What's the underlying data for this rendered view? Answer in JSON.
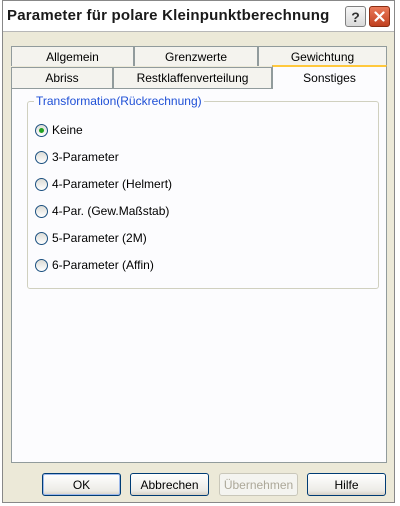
{
  "window": {
    "title": "Parameter für polare Kleinpunktberechnung",
    "help_button": "?",
    "close_button": "close"
  },
  "tabs": {
    "row_back": [
      "Allgemein",
      "Grenzwerte",
      "Gewichtung"
    ],
    "row_front": [
      "Abriss",
      "Restklaffenverteilung",
      "Sonstiges"
    ],
    "active": "Sonstiges"
  },
  "transformation": {
    "group_label": "Transformation(Rückrechnung)",
    "options": [
      {
        "label": "Keine",
        "selected": true
      },
      {
        "label": "3-Parameter",
        "selected": false
      },
      {
        "label": "4-Parameter (Helmert)",
        "selected": false
      },
      {
        "label": "4-Par. (Gew.Maßstab)",
        "selected": false
      },
      {
        "label": "5-Parameter (2M)",
        "selected": false
      },
      {
        "label": "6-Parameter (Affin)",
        "selected": false
      }
    ]
  },
  "buttons": {
    "ok": "OK",
    "cancel": "Abbrechen",
    "apply": "Übernehmen",
    "help": "Hilfe"
  },
  "colors": {
    "tab_highlight": "#FFC83C",
    "group_label": "#1E4FD6",
    "radio_dot": "#21A121",
    "close_button": "#C1401F"
  }
}
